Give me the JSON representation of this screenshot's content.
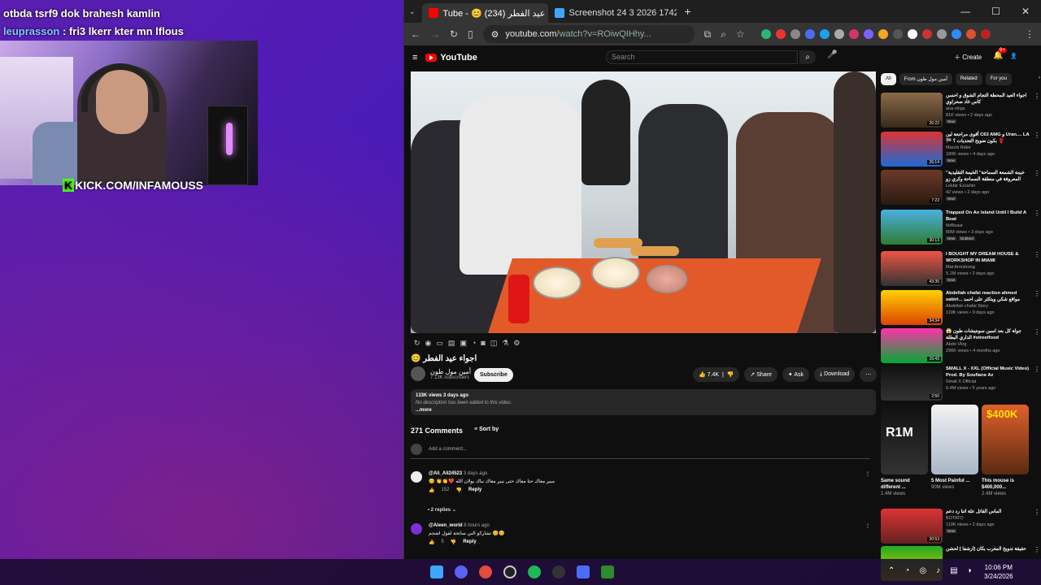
{
  "overlay": {
    "chat": [
      {
        "text": "otbda tsrf9 dok brahesh kamlin"
      },
      {
        "user": "leuprasson",
        "text": ": fri3 lkerr kter mn lflous"
      }
    ],
    "kick": "KICK.COM/INFAMOUSS"
  },
  "browser": {
    "tabs": [
      {
        "label": "Tube - 😊 اجواء عيد الفطر (234)"
      },
      {
        "label": "Screenshot 24 3 2026 17422 w"
      }
    ],
    "url": "youtube.com",
    "url_rest": "/watch?v=ROiwQIHhy..."
  },
  "youtube": {
    "logo": "YouTube",
    "search_placeholder": "Search",
    "create": "Create",
    "notif_count": "9+",
    "video_title": "اجواء عيد الفطر 😊",
    "channel": {
      "name": "أمين مول طون",
      "subs": "7.13K subscribers"
    },
    "subscribe": "Subscribe",
    "likes": "7.4K",
    "share": "Share",
    "ask": "Ask",
    "download": "Download",
    "views": "133K views  3 days ago",
    "description": "No description has been added to this video.",
    "more": "...more",
    "comments_count": "271 Comments",
    "sort_by": "Sort by",
    "add_comment": "Add a comment...",
    "comments": [
      {
        "user": "@Ali_Ali24523",
        "time": "3 days ago",
        "text": "😊 👏👏❤️ مبير معاك حتا معاك حتى نبير معاك نباك يولان الله",
        "likes": "152",
        "reply": "Reply"
      },
      {
        "user": "@Aleen_world",
        "time": "8 hours ago",
        "text": "تشاركو الني ساتحة لقول اشحم 😊😊",
        "likes": "5",
        "reply": "Reply"
      }
    ],
    "replies": "2 replies",
    "chips": [
      "All",
      "From أمين مول طون",
      "Related",
      "For you"
    ],
    "recommendations": [
      {
        "title": "اجواء العيد المحطة التجام الشوق و احسن كاس غاد صحراوي",
        "channel": "ana vlogs",
        "meta": "81K views • 2 days ago",
        "duration": "26:22",
        "badge": "New"
      },
      {
        "title": "أقوى مراجعة لين C63 AMG و Uran.... LA 🏁 بكون ضوبح التحديات ؟ 🥊",
        "channel": "Marcki Rider",
        "meta": "180K views • 4 days ago",
        "duration": "26:14",
        "badge": "New"
      },
      {
        "title": "\"خيمة الشمعة السماحة\" الخيمة التقليدية المعروفة في منطقة السماحة وكري زو",
        "channel": "Lekbir Ezzahiri",
        "meta": "42 views • 2 days ago",
        "duration": "7:23",
        "badge": "New"
      },
      {
        "title": "Trapped On An Island Until I Build A Boat",
        "channel": "MrBeast",
        "meta": "66M views • 3 days ago",
        "duration": "30:13",
        "badge": "New",
        "badge2": "Dubbed"
      },
      {
        "title": "I BOUGHT MY DREAM HOUSE & WORKSHOP IN MIAMI",
        "channel": "Mat Armstrong",
        "meta": "5.1M views • 2 days ago",
        "duration": "43:35",
        "badge": "New"
      },
      {
        "title": "Abdellah chafai reaction ahmed sabiri... مواقع شكي ويتكثر على احمد",
        "channel": "Abdellah chafai Story",
        "meta": "110K views • 9 days ago",
        "duration": "34:34",
        "badge": ""
      },
      {
        "title": "جولة كل بعد اسبن سونتيشات طون 😱 الداري البطلة #streetfood",
        "channel": "Abdo Vlog",
        "meta": "296K views • 4 months ago",
        "duration": "16:43",
        "badge": ""
      },
      {
        "title": "SMALL X - XXL (Official Music Video) Prod. By Soufiane Az",
        "channel": "Small X Official",
        "meta": "6.4M views • 5 years ago",
        "duration": "2:50",
        "badge": ""
      }
    ],
    "shorts": [
      {
        "title": "Same sound different ...",
        "views": "1.4M views",
        "label": "R1M"
      },
      {
        "title": "5 Most Painful ...",
        "views": "90M views",
        "label": ""
      },
      {
        "title": "This mouse is $400,000...",
        "views": "2.4M views",
        "label": "$400K"
      }
    ],
    "more_recs": [
      {
        "title": "الماس القاتل علة اتنا رد دعم",
        "channel": "BOTATO",
        "meta": "110K views • 2 days ago",
        "duration": "30:53",
        "badge": "New"
      },
      {
        "title": "حقيقة تدويخ المغرب بكان [ارشفا ] لحشن",
        "channel": "",
        "meta": "",
        "duration": "",
        "badge": ""
      }
    ]
  },
  "taskbar": {
    "time": "10:06 PM",
    "date": "3/24/2026"
  },
  "colors": {
    "yt_red": "#ff0000",
    "kick_green": "#53fc18",
    "accent": "#3ea6ff"
  }
}
